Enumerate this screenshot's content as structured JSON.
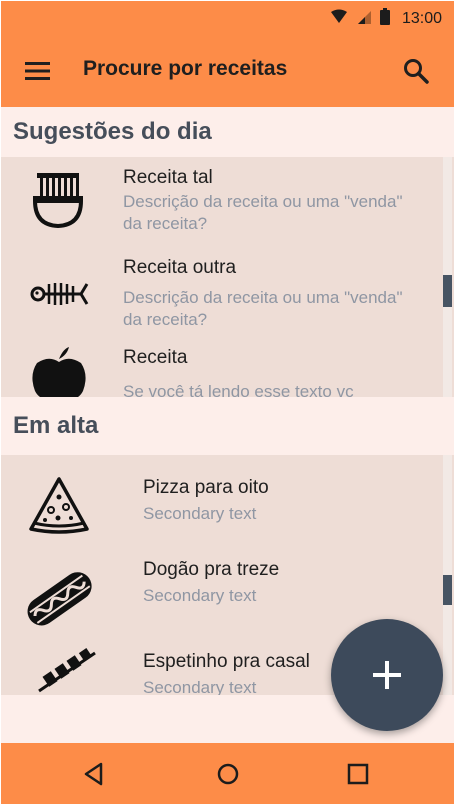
{
  "status_bar": {
    "time": "13:00",
    "icons": [
      "wifi-icon",
      "signal-icon",
      "battery-icon"
    ]
  },
  "app_bar": {
    "title": "Procure por receitas",
    "icons": [
      "menu-icon",
      "search-icon"
    ]
  },
  "sections": [
    {
      "header": "Sugestões do dia",
      "items": [
        {
          "icon": "noodle-bowl-icon",
          "title": "Receita tal",
          "description": "Descrição da receita ou uma \"venda\" da receita?"
        },
        {
          "icon": "fish-bone-icon",
          "title": "Receita outra",
          "description": "Descrição da receita ou uma \"venda\" da receita?"
        },
        {
          "icon": "apple-icon",
          "title": "Receita",
          "description": "Se você tá lendo esse texto vc"
        }
      ]
    },
    {
      "header": "Em alta",
      "items": [
        {
          "icon": "pizza-slice-icon",
          "title": "Pizza para oito",
          "description": "Secondary text"
        },
        {
          "icon": "hot-dog-icon",
          "title": "Dogão pra treze",
          "description": "Secondary text"
        },
        {
          "icon": "skewer-icon",
          "title": "Espetinho pra casal",
          "description": "Secondary text"
        }
      ]
    }
  ],
  "fab": {
    "icon": "plus-icon"
  },
  "nav_bar": {
    "icons": [
      "back-icon",
      "home-icon",
      "recents-icon"
    ]
  },
  "colors": {
    "primary": "#fd8c48",
    "section_header_bg": "#fdeeea",
    "list_bg": "#eeddd6",
    "fab": "#3d4a5b",
    "secondary_text": "#8f96a3",
    "header_text": "#464e5a"
  }
}
